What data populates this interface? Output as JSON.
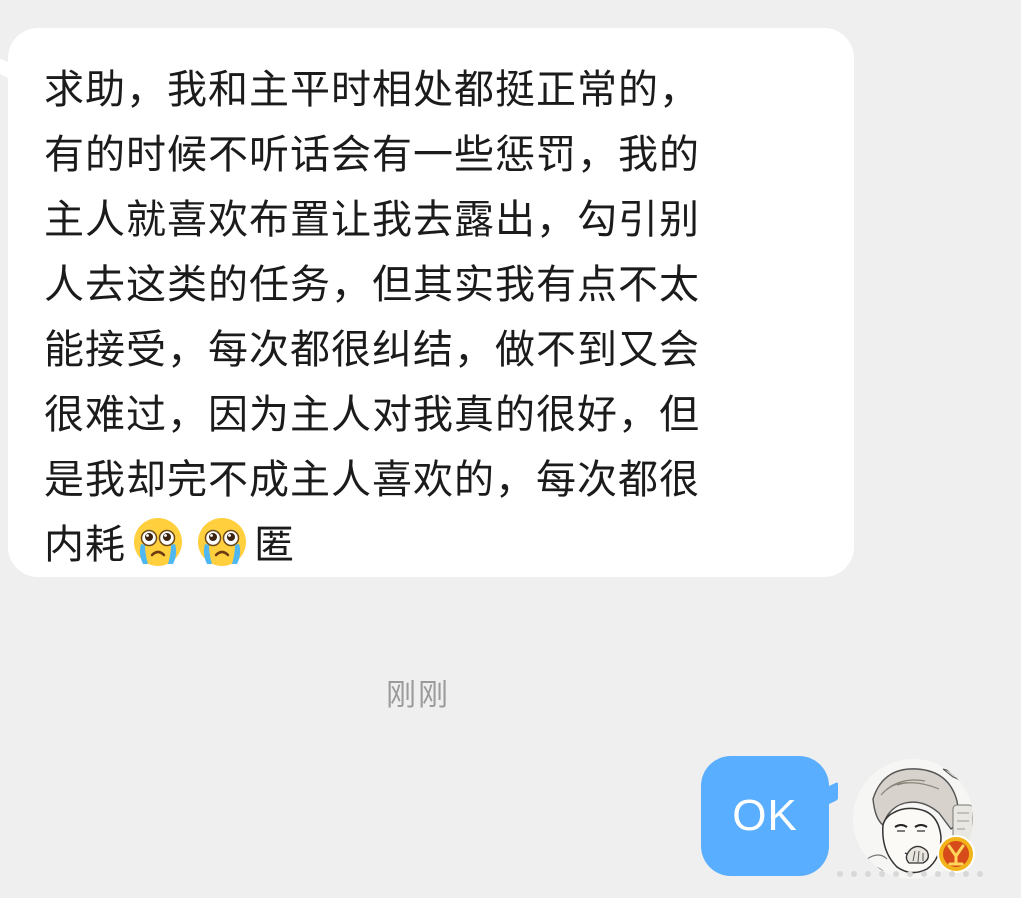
{
  "incoming_message": {
    "lines": [
      "求助，我和主平时相处都挺正常的，",
      "有的时候不听话会有一些惩罚，我的",
      "主人就喜欢布置让我去露出，勾引别",
      "人去这类的任务，但其实我有点不太",
      "能接受，每次都很纠结，做不到又会",
      "很难过，因为主人对我真的很好，但",
      "是我却完不成主人喜欢的，每次都很"
    ],
    "last_line_start": "内耗",
    "last_line_end": "匿",
    "emojis": [
      "crying-face",
      "crying-face"
    ]
  },
  "timestamp": "刚刚",
  "outgoing_message": {
    "text": "OK"
  },
  "avatar": {
    "icon": "manga-portrait-avatar",
    "badge_icon": "gold-badge-icon"
  },
  "colors": {
    "background": "#efeff0",
    "incoming_bubble": "#ffffff",
    "outgoing_bubble": "#5aaeff",
    "message_text": "#1b1b1b",
    "timestamp_text": "#9b9b9b"
  }
}
